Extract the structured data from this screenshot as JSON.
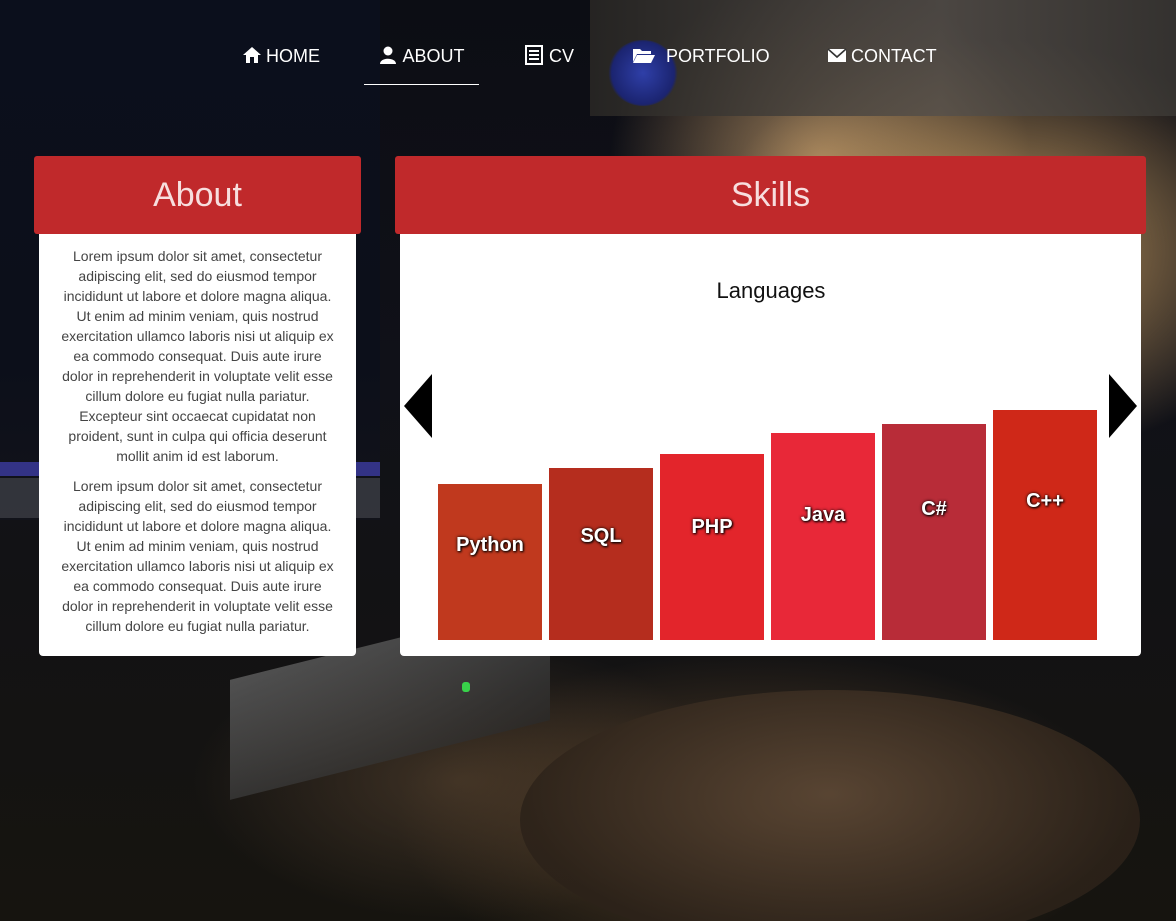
{
  "nav": {
    "items": [
      {
        "label": "HOME",
        "icon": "home-icon"
      },
      {
        "label": "ABOUT",
        "icon": "user-icon",
        "active": true
      },
      {
        "label": "CV",
        "icon": "document-list-icon"
      },
      {
        "label": "PORTFOLIO",
        "icon": "folder-open-icon"
      },
      {
        "label": "CONTACT",
        "icon": "envelope-icon"
      }
    ]
  },
  "about": {
    "title": "About",
    "paragraphs": [
      "Lorem ipsum dolor sit amet, consectetur adipiscing elit, sed do eiusmod tempor incididunt ut labore et dolore magna aliqua. Ut enim ad minim veniam, quis nostrud exercitation ullamco laboris nisi ut aliquip ex ea commodo consequat. Duis aute irure dolor in reprehenderit in voluptate velit esse cillum dolore eu fugiat nulla pariatur. Excepteur sint occaecat cupidatat non proident, sunt in culpa qui officia deserunt mollit anim id est laborum.",
      "Lorem ipsum dolor sit amet, consectetur adipiscing elit, sed do eiusmod tempor incididunt ut labore et dolore magna aliqua. Ut enim ad minim veniam, quis nostrud exercitation ullamco laboris nisi ut aliquip ex ea commodo consequat. Duis aute irure dolor in reprehenderit in voluptate velit esse cillum dolore eu fugiat nulla pariatur."
    ]
  },
  "skills": {
    "title": "Skills"
  },
  "colors": {
    "header_red": "#c0292b",
    "bar_colors": [
      "#c0391e",
      "#b52d1e",
      "#e3252b",
      "#e82838",
      "#b82c38",
      "#cf2818"
    ]
  },
  "chart_data": {
    "type": "bar",
    "title": "Languages",
    "categories": [
      "Python",
      "SQL",
      "PHP",
      "Java",
      "C#",
      "C++"
    ],
    "values": [
      68,
      75,
      81,
      90,
      94,
      100
    ],
    "ylim": [
      0,
      100
    ],
    "grid": false
  }
}
